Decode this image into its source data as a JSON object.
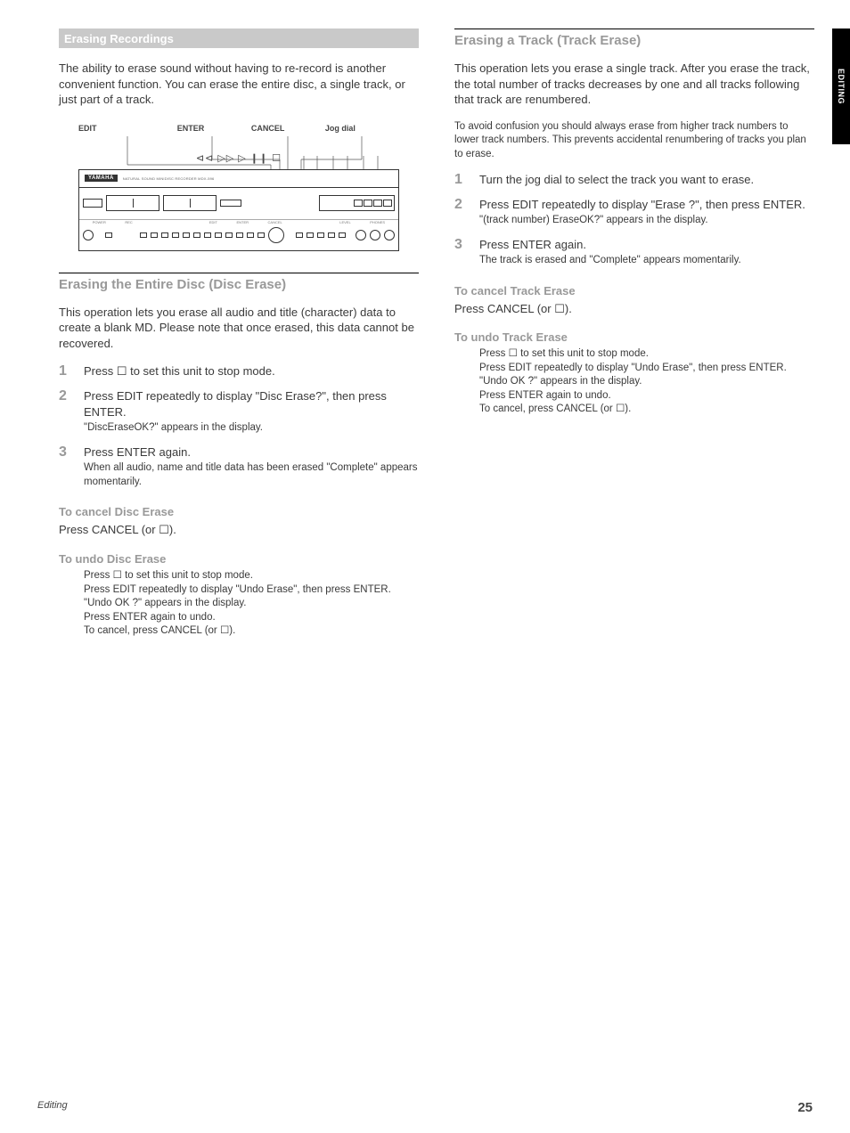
{
  "sideTab": "EDITING",
  "left": {
    "mainTitle": "Erasing Recordings",
    "intro": "The ability to erase sound without having to re-record is another convenient function. You can erase the entire disc, a single track, or just part of a track.",
    "callouts": [
      "EDIT",
      "ENTER",
      "CANCEL",
      "Jog dial"
    ],
    "transport": "⊲⊲ ▷▷   ▷  ❙❙  ☐",
    "brand": "YAMAHA",
    "product": "NATURAL SOUND MINIDISC RECORDER MDX-596",
    "section1": {
      "title": "Erasing the Entire Disc (Disc Erase)",
      "text": "This operation lets you erase all audio and title (character) data to create a blank MD. Please note that once erased, this data cannot be recovered.",
      "steps": [
        {
          "n": "1",
          "t": "Press ☐ to set this unit to stop mode."
        },
        {
          "n": "2",
          "t": "Press EDIT repeatedly to display \"Disc Erase?\", then press ENTER.",
          "sub": "\"DiscEraseOK?\" appears in the display."
        },
        {
          "n": "3",
          "t": "Press ENTER again.",
          "sub": "When all audio, name and title data has been erased \"Complete\" appears momentarily."
        }
      ],
      "cancel": {
        "head": "To cancel Disc Erase",
        "text_pre": "Press ",
        "text_mid": "CANCEL",
        "text_post": " (or ☐)."
      },
      "undo": {
        "head": "To undo Disc Erase",
        "lines": [
          "Press ☐ to set this unit to stop mode.",
          "Press EDIT repeatedly to display \"Undo Erase\", then press ENTER.",
          "\"Undo OK ?\" appears in the display.",
          "Press ENTER again to undo.",
          "To cancel, press CANCEL (or ☐)."
        ]
      }
    }
  },
  "right": {
    "section": {
      "title": "Erasing a Track (Track Erase)",
      "p1": "This operation lets you erase a single track. After you erase the track, the total number of tracks decreases by one and all tracks following that track are renumbered.",
      "p2": "To avoid confusion you should always erase from higher track numbers to lower track numbers. This prevents accidental renumbering of tracks you plan to erase.",
      "steps": [
        {
          "n": "1",
          "t": "Turn the jog dial to select the track you want to erase."
        },
        {
          "n": "2",
          "t": "Press EDIT repeatedly to display \"Erase ?\", then press ENTER.",
          "sub": "\"(track number) EraseOK?\" appears in the display."
        },
        {
          "n": "3",
          "t": "Press ENTER again.",
          "sub": "The track is erased and \"Complete\" appears momentarily."
        }
      ],
      "cancel": {
        "head": "To cancel Track Erase",
        "text_pre": "Press ",
        "text_mid": "CANCEL",
        "text_post": " (or ☐)."
      },
      "undo": {
        "head": "To undo Track Erase",
        "lines": [
          "Press ☐ to set this unit to stop mode.",
          "Press EDIT repeatedly to display \"Undo Erase\", then press ENTER.",
          "\"Undo OK ?\" appears in the display.",
          "Press ENTER again to undo.",
          "To cancel, press CANCEL (or ☐)."
        ]
      }
    }
  },
  "footer": {
    "left": "Editing",
    "right": "25"
  }
}
